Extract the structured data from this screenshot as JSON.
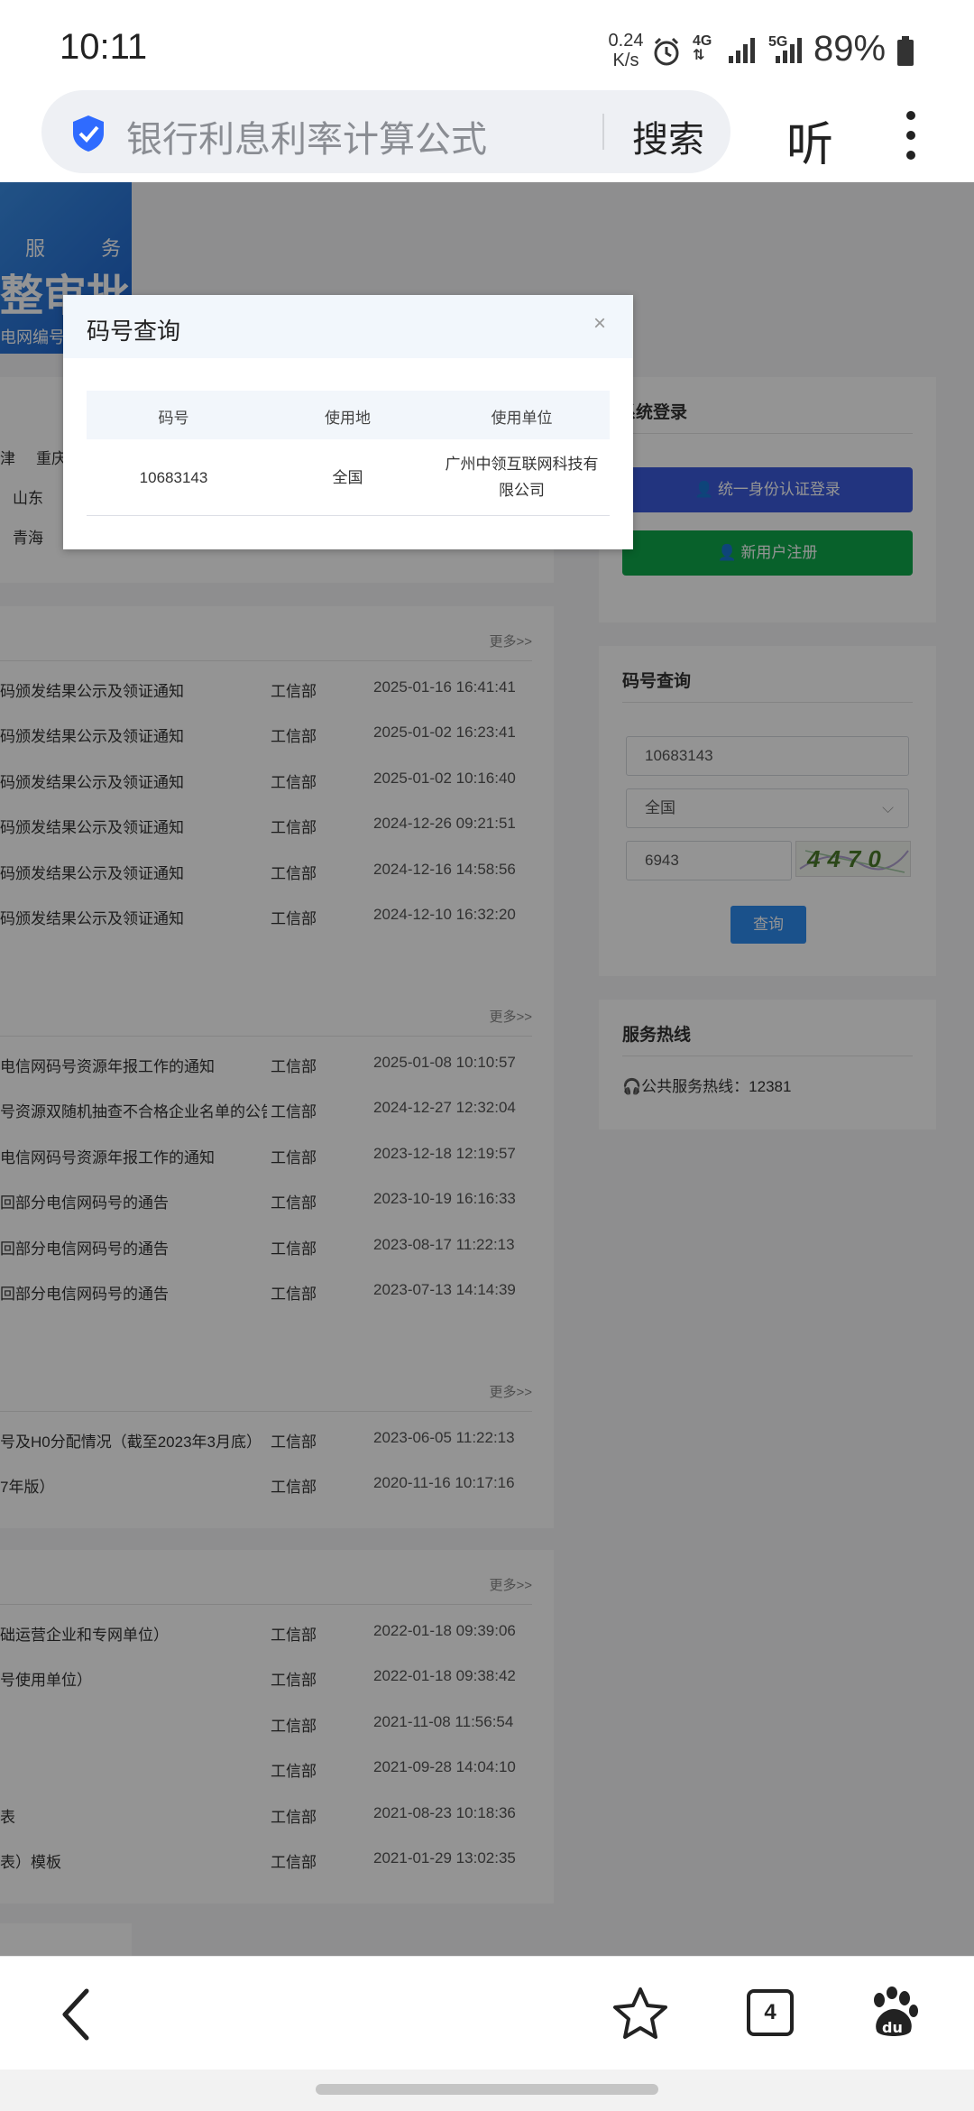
{
  "status_bar": {
    "time": "10:11",
    "speed_value": "0.24",
    "speed_unit": "K/s",
    "net1": "4G",
    "net2": "5G",
    "battery": "89%"
  },
  "browser": {
    "query": "银行利息利率计算公式",
    "search_label": "搜索",
    "listen_label": "听"
  },
  "background_page": {
    "banner_top": "服 务",
    "banner_main": "整审批",
    "banner_sub": "电网编号计",
    "regions": [
      "津",
      "重庆",
      "山东",
      "青海"
    ],
    "more_label": "更多>>",
    "sections": [
      {
        "rows": [
          {
            "title": "码颁发结果公示及领证通知",
            "source": "工信部",
            "date": "2025-01-16 16:41:41"
          },
          {
            "title": "码颁发结果公示及领证通知",
            "source": "工信部",
            "date": "2025-01-02 16:23:41"
          },
          {
            "title": "码颁发结果公示及领证通知",
            "source": "工信部",
            "date": "2025-01-02 10:16:40"
          },
          {
            "title": "码颁发结果公示及领证通知",
            "source": "工信部",
            "date": "2024-12-26 09:21:51"
          },
          {
            "title": "码颁发结果公示及领证通知",
            "source": "工信部",
            "date": "2024-12-16 14:58:56"
          },
          {
            "title": "码颁发结果公示及领证通知",
            "source": "工信部",
            "date": "2024-12-10 16:32:20"
          }
        ]
      },
      {
        "rows": [
          {
            "title": "电信网码号资源年报工作的通知",
            "source": "工信部",
            "date": "2025-01-08 10:10:57"
          },
          {
            "title": "号资源双随机抽查不合格企业名单的公告",
            "source": "工信部",
            "date": "2024-12-27 12:32:04"
          },
          {
            "title": "电信网码号资源年报工作的通知",
            "source": "工信部",
            "date": "2023-12-18 12:19:57"
          },
          {
            "title": "回部分电信网码号的通告",
            "source": "工信部",
            "date": "2023-10-19 16:16:33"
          },
          {
            "title": "回部分电信网码号的通告",
            "source": "工信部",
            "date": "2023-08-17 11:22:13"
          },
          {
            "title": "回部分电信网码号的通告",
            "source": "工信部",
            "date": "2023-07-13 14:14:39"
          }
        ]
      },
      {
        "rows": [
          {
            "title": "号及H0分配情况（截至2023年3月底）",
            "source": "工信部",
            "date": "2023-06-05 11:22:13"
          },
          {
            "title": "7年版）",
            "source": "工信部",
            "date": "2020-11-16 10:17:16"
          }
        ]
      },
      {
        "rows": [
          {
            "title": "础运营企业和专网单位）",
            "source": "工信部",
            "date": "2022-01-18 09:39:06"
          },
          {
            "title": "号使用单位）",
            "source": "工信部",
            "date": "2022-01-18 09:38:42"
          },
          {
            "title": "",
            "source": "工信部",
            "date": "2021-11-08 11:56:54"
          },
          {
            "title": "",
            "source": "工信部",
            "date": "2021-09-28 14:04:10"
          },
          {
            "title": "表",
            "source": "工信部",
            "date": "2021-08-23 10:18:36"
          },
          {
            "title": "表）模板",
            "source": "工信部",
            "date": "2021-01-29 13:02:35"
          }
        ]
      }
    ],
    "login": {
      "title": "系统登录",
      "unified_login": "统一身份认证登录",
      "register": "新用户注册"
    },
    "code_query": {
      "title": "码号查询",
      "code_value": "10683143",
      "region_value": "全国",
      "captcha_input": "6943",
      "captcha_image_text": "4470",
      "query_button": "查询"
    },
    "hotline": {
      "title": "服务热线",
      "text": "公共服务热线：12381"
    }
  },
  "modal": {
    "title": "码号查询",
    "close": "×",
    "columns": [
      "码号",
      "使用地",
      "使用单位"
    ],
    "row": {
      "code": "10683143",
      "location": "全国",
      "unit_line1": "广州中领互联网科技有",
      "unit_line2": "限公司"
    }
  },
  "bottom_nav": {
    "tab_count": "4"
  },
  "colors": {
    "login_blue": "#3b5bdb",
    "register_green": "#0fa84a",
    "query_blue": "#2d8cf0",
    "shield_blue": "#2f6bff"
  }
}
